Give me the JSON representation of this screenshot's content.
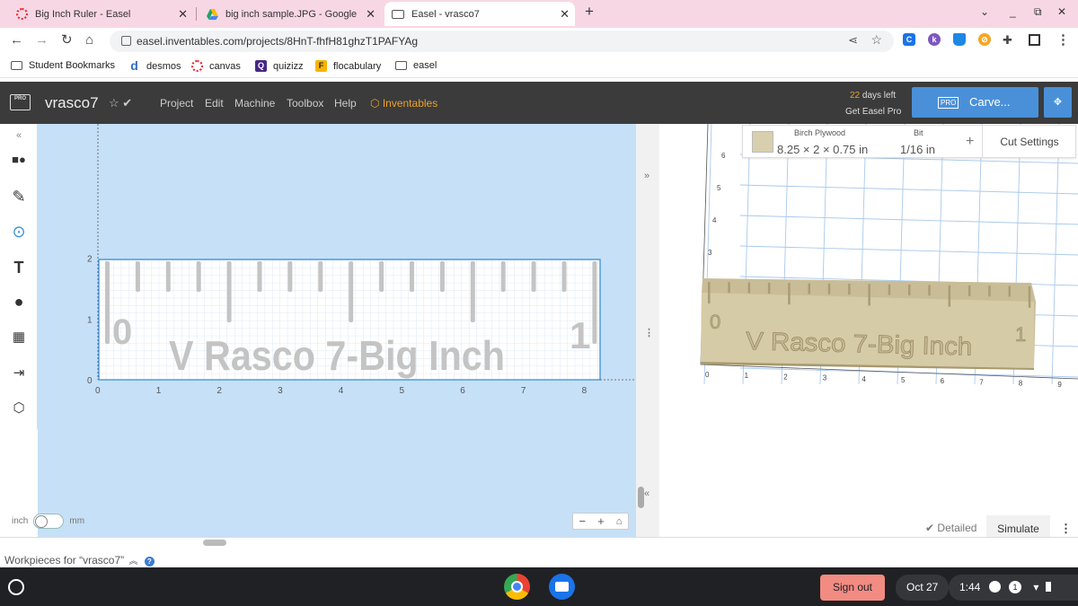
{
  "browser": {
    "tabs": [
      {
        "title": "Big Inch Ruler - Easel"
      },
      {
        "title": "big inch sample.JPG - Google Dr"
      },
      {
        "title": "Easel - vrasco7"
      }
    ],
    "new_tab": "+",
    "url": "easel.inventables.com/projects/8HnT-fhfH81ghzT1PAFYAg",
    "bookmarks": [
      "Student Bookmarks",
      "desmos",
      "canvas",
      "quizizz",
      "flocabulary",
      "easel"
    ]
  },
  "app": {
    "project_name": "vrasco7",
    "menu": [
      "Project",
      "Edit",
      "Machine",
      "Toolbox",
      "Help",
      "Inventables"
    ],
    "trial_days": "22",
    "trial_suffix": " days left",
    "get_pro": "Get Easel Pro",
    "pro_badge": "PRO",
    "carve_label": "Carve...",
    "logo_text": "PRO"
  },
  "canvas": {
    "x_ticks": [
      "0",
      "1",
      "2",
      "3",
      "4",
      "5",
      "6",
      "7",
      "8"
    ],
    "y_ticks": [
      "0",
      "1",
      "2"
    ],
    "ruler_text": "V Rasco 7-Big Inch",
    "ruler_left_num": "0",
    "ruler_right_num": "1",
    "units_left": "inch",
    "units_right": "mm",
    "zoom_minus": "−",
    "zoom_plus": "+"
  },
  "preview": {
    "material_title": "Birch Plywood",
    "material_dims": "8.25 × 2 × 0.75 in",
    "bit_title": "Bit",
    "bit_value": "1/16 in",
    "cut_settings": "Cut Settings",
    "x_ticks": [
      "0",
      "1",
      "2",
      "3",
      "4",
      "5",
      "6",
      "7",
      "8",
      "9"
    ],
    "y_ticks": [
      "3",
      "4",
      "5",
      "6"
    ],
    "detailed": "Detailed",
    "simulate": "Simulate",
    "ruler_text": "V Rasco 7-Big Inch",
    "ruler_left_num": "0",
    "ruler_right_num": "1"
  },
  "workpieces": {
    "label": "Workpieces for “vrasco7”"
  },
  "shelf": {
    "sign_out": "Sign out",
    "date": "Oct 27",
    "time": "1:44",
    "notif_count": "1"
  },
  "colors": {
    "accent": "#4a90d9",
    "header": "#3b3b3b",
    "canvas_bg": "#c6e0f7",
    "tab_bar": "#f8d7e4",
    "sign_out": "#f28b82"
  }
}
